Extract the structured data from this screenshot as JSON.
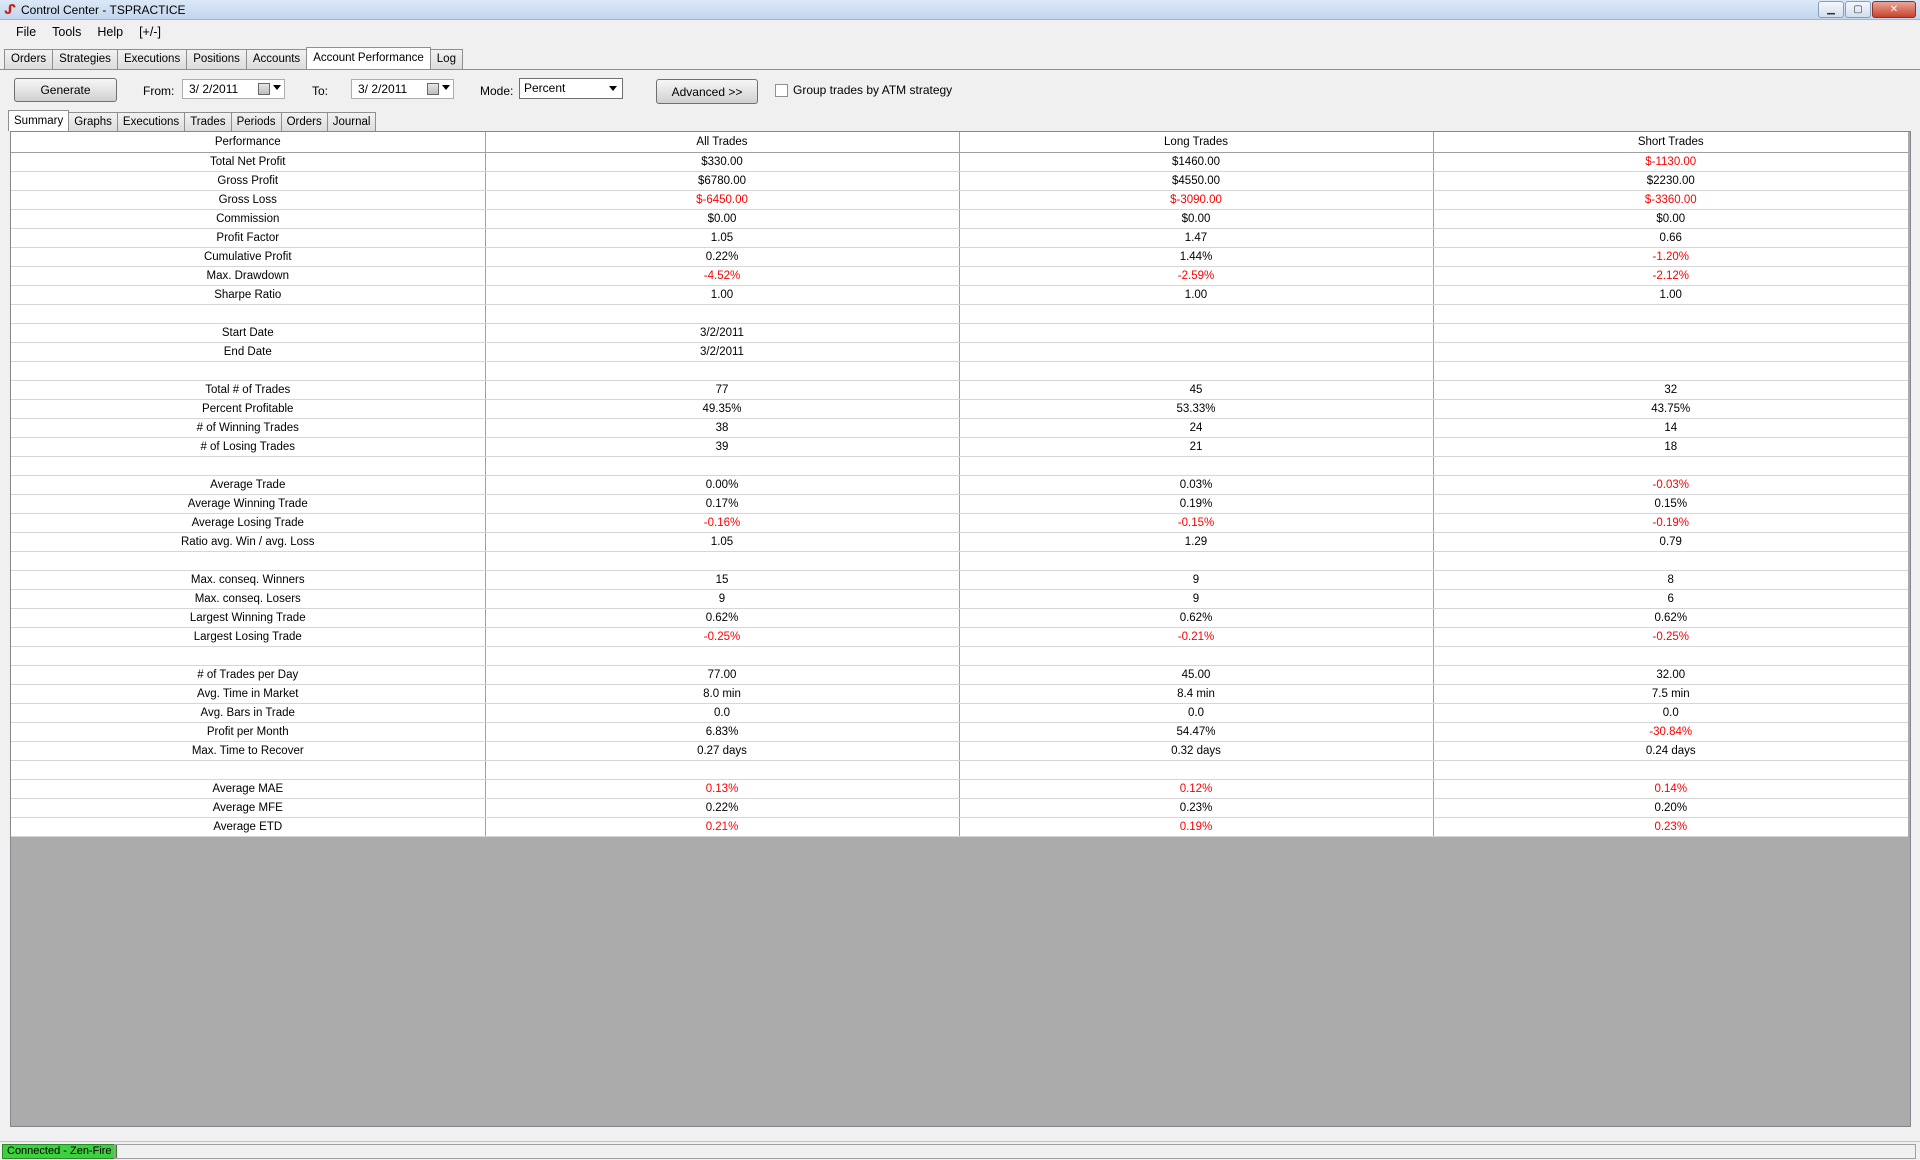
{
  "window": {
    "title": "Control Center - TSPRACTICE"
  },
  "menu": [
    "File",
    "Tools",
    "Help",
    "[+/-]"
  ],
  "main_tabs": [
    "Orders",
    "Strategies",
    "Executions",
    "Positions",
    "Accounts",
    "Account Performance",
    "Log"
  ],
  "toolbar": {
    "generate_label": "Generate",
    "from_label": "From:",
    "from_value": "3/ 2/2011",
    "to_label": "To:",
    "to_value": "3/ 2/2011",
    "mode_label": "Mode:",
    "mode_value": "Percent",
    "advanced_label": "Advanced >>",
    "group_label": "Group trades by ATM strategy"
  },
  "sub_tabs": [
    "Summary",
    "Graphs",
    "Executions",
    "Trades",
    "Periods",
    "Orders",
    "Journal"
  ],
  "table": {
    "headers": [
      "Performance",
      "All Trades",
      "Long Trades",
      "Short Trades"
    ],
    "rows": [
      [
        "Total Net Profit",
        "$330.00",
        "$1460.00",
        "$-1130.00"
      ],
      [
        "Gross Profit",
        "$6780.00",
        "$4550.00",
        "$2230.00"
      ],
      [
        "Gross Loss",
        "$-6450.00",
        "$-3090.00",
        "$-3360.00"
      ],
      [
        "Commission",
        "$0.00",
        "$0.00",
        "$0.00"
      ],
      [
        "Profit Factor",
        "1.05",
        "1.47",
        "0.66"
      ],
      [
        "Cumulative Profit",
        "0.22%",
        "1.44%",
        "-1.20%"
      ],
      [
        "Max. Drawdown",
        "-4.52%",
        "-2.59%",
        "-2.12%"
      ],
      [
        "Sharpe Ratio",
        "1.00",
        "1.00",
        "1.00"
      ],
      [
        "",
        "",
        "",
        ""
      ],
      [
        "Start Date",
        "3/2/2011",
        "",
        ""
      ],
      [
        "End Date",
        "3/2/2011",
        "",
        ""
      ],
      [
        "",
        "",
        "",
        ""
      ],
      [
        "Total # of Trades",
        "77",
        "45",
        "32"
      ],
      [
        "Percent Profitable",
        "49.35%",
        "53.33%",
        "43.75%"
      ],
      [
        "# of Winning Trades",
        "38",
        "24",
        "14"
      ],
      [
        "# of Losing Trades",
        "39",
        "21",
        "18"
      ],
      [
        "",
        "",
        "",
        ""
      ],
      [
        "Average Trade",
        "0.00%",
        "0.03%",
        "-0.03%"
      ],
      [
        "Average Winning Trade",
        "0.17%",
        "0.19%",
        "0.15%"
      ],
      [
        "Average Losing Trade",
        "-0.16%",
        "-0.15%",
        "-0.19%"
      ],
      [
        "Ratio avg. Win / avg. Loss",
        "1.05",
        "1.29",
        "0.79"
      ],
      [
        "",
        "",
        "",
        ""
      ],
      [
        "Max. conseq. Winners",
        "15",
        "9",
        "8"
      ],
      [
        "Max. conseq. Losers",
        "9",
        "9",
        "6"
      ],
      [
        "Largest Winning Trade",
        "0.62%",
        "0.62%",
        "0.62%"
      ],
      [
        "Largest Losing Trade",
        "-0.25%",
        "-0.21%",
        "-0.25%"
      ],
      [
        "",
        "",
        "",
        ""
      ],
      [
        "# of Trades per Day",
        "77.00",
        "45.00",
        "32.00"
      ],
      [
        "Avg. Time in Market",
        "8.0 min",
        "8.4 min",
        "7.5 min"
      ],
      [
        "Avg. Bars in Trade",
        "0.0",
        "0.0",
        "0.0"
      ],
      [
        "Profit per Month",
        "6.83%",
        "54.47%",
        "-30.84%"
      ],
      [
        "Max. Time to Recover",
        "0.27 days",
        "0.32 days",
        "0.24 days"
      ],
      [
        "",
        "",
        "",
        ""
      ],
      [
        "Average MAE",
        "0.13%",
        "0.12%",
        "0.14%"
      ],
      [
        "Average MFE",
        "0.22%",
        "0.23%",
        "0.20%"
      ],
      [
        "Average ETD",
        "0.21%",
        "0.19%",
        "0.23%"
      ]
    ],
    "red_cells": [
      [
        0,
        3
      ],
      [
        2,
        1
      ],
      [
        2,
        2
      ],
      [
        2,
        3
      ],
      [
        5,
        3
      ],
      [
        6,
        1
      ],
      [
        6,
        2
      ],
      [
        6,
        3
      ],
      [
        17,
        3
      ],
      [
        19,
        1
      ],
      [
        19,
        2
      ],
      [
        19,
        3
      ],
      [
        25,
        1
      ],
      [
        25,
        2
      ],
      [
        25,
        3
      ],
      [
        30,
        3
      ],
      [
        33,
        1
      ],
      [
        33,
        2
      ],
      [
        33,
        3
      ],
      [
        35,
        1
      ],
      [
        35,
        2
      ],
      [
        35,
        3
      ]
    ]
  },
  "status": {
    "connection": "Connected - Zen-Fire"
  },
  "colors": {
    "negative": "#ff0000",
    "connected": "#3dd13d",
    "empty_area": "#ababab"
  }
}
